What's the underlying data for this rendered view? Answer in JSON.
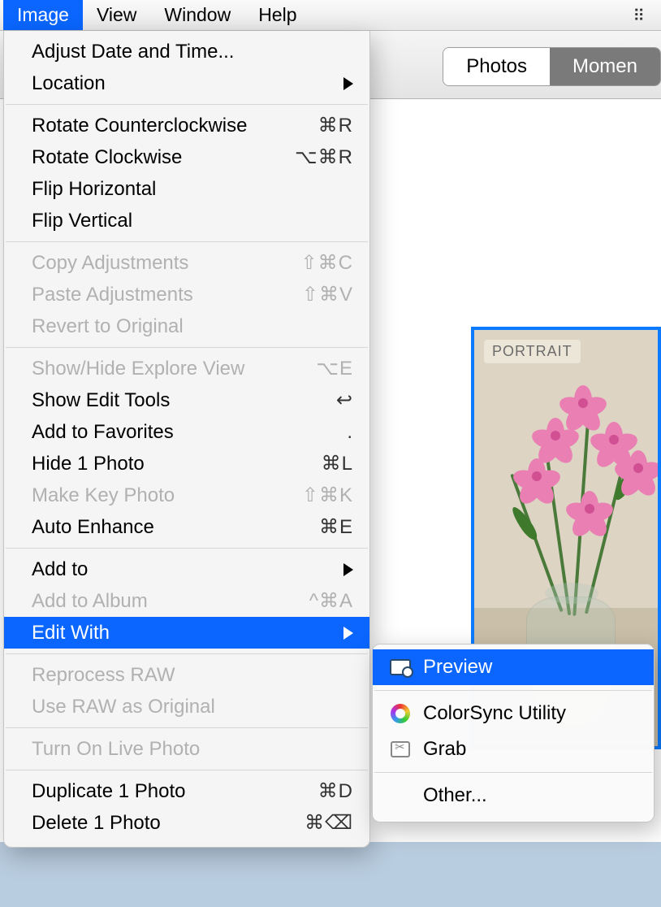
{
  "menubar": {
    "items": [
      "Image",
      "View",
      "Window",
      "Help"
    ],
    "active_index": 0,
    "right_icon": "dropbox-icon"
  },
  "toolbar": {
    "segments": [
      "Photos",
      "Momen"
    ]
  },
  "thumbnail": {
    "badge": "PORTRAIT"
  },
  "dropdown": {
    "groups": [
      [
        {
          "label": "Adjust Date and Time...",
          "shortcut": "",
          "disabled": false,
          "submenu": false
        },
        {
          "label": "Location",
          "shortcut": "",
          "disabled": false,
          "submenu": true
        }
      ],
      [
        {
          "label": "Rotate Counterclockwise",
          "shortcut": "⌘R",
          "disabled": false,
          "submenu": false
        },
        {
          "label": "Rotate Clockwise",
          "shortcut": "⌥⌘R",
          "disabled": false,
          "submenu": false
        },
        {
          "label": "Flip Horizontal",
          "shortcut": "",
          "disabled": false,
          "submenu": false
        },
        {
          "label": "Flip Vertical",
          "shortcut": "",
          "disabled": false,
          "submenu": false
        }
      ],
      [
        {
          "label": "Copy Adjustments",
          "shortcut": "⇧⌘C",
          "disabled": true,
          "submenu": false
        },
        {
          "label": "Paste Adjustments",
          "shortcut": "⇧⌘V",
          "disabled": true,
          "submenu": false
        },
        {
          "label": "Revert to Original",
          "shortcut": "",
          "disabled": true,
          "submenu": false
        }
      ],
      [
        {
          "label": "Show/Hide Explore View",
          "shortcut": "⌥E",
          "disabled": true,
          "submenu": false
        },
        {
          "label": "Show Edit Tools",
          "shortcut": "↩",
          "disabled": false,
          "submenu": false
        },
        {
          "label": "Add to Favorites",
          "shortcut": ".",
          "disabled": false,
          "submenu": false
        },
        {
          "label": "Hide 1 Photo",
          "shortcut": "⌘L",
          "disabled": false,
          "submenu": false
        },
        {
          "label": "Make Key Photo",
          "shortcut": "⇧⌘K",
          "disabled": true,
          "submenu": false
        },
        {
          "label": "Auto Enhance",
          "shortcut": "⌘E",
          "disabled": false,
          "submenu": false
        }
      ],
      [
        {
          "label": "Add to",
          "shortcut": "",
          "disabled": false,
          "submenu": true
        },
        {
          "label": "Add to Album",
          "shortcut": "^⌘A",
          "disabled": true,
          "submenu": false
        },
        {
          "label": "Edit With",
          "shortcut": "",
          "disabled": false,
          "submenu": true,
          "highlight": true
        }
      ],
      [
        {
          "label": "Reprocess RAW",
          "shortcut": "",
          "disabled": true,
          "submenu": false
        },
        {
          "label": "Use RAW as Original",
          "shortcut": "",
          "disabled": true,
          "submenu": false
        }
      ],
      [
        {
          "label": "Turn On Live Photo",
          "shortcut": "",
          "disabled": true,
          "submenu": false
        }
      ],
      [
        {
          "label": "Duplicate 1 Photo",
          "shortcut": "⌘D",
          "disabled": false,
          "submenu": false
        },
        {
          "label": "Delete 1 Photo",
          "shortcut": "⌘⌫",
          "disabled": false,
          "submenu": false
        }
      ]
    ]
  },
  "submenu": {
    "groups": [
      [
        {
          "label": "Preview",
          "icon": "preview",
          "highlight": true
        }
      ],
      [
        {
          "label": "ColorSync Utility",
          "icon": "colorsync",
          "highlight": false
        },
        {
          "label": "Grab",
          "icon": "grab",
          "highlight": false
        }
      ],
      [
        {
          "label": "Other...",
          "icon": "",
          "highlight": false
        }
      ]
    ]
  }
}
